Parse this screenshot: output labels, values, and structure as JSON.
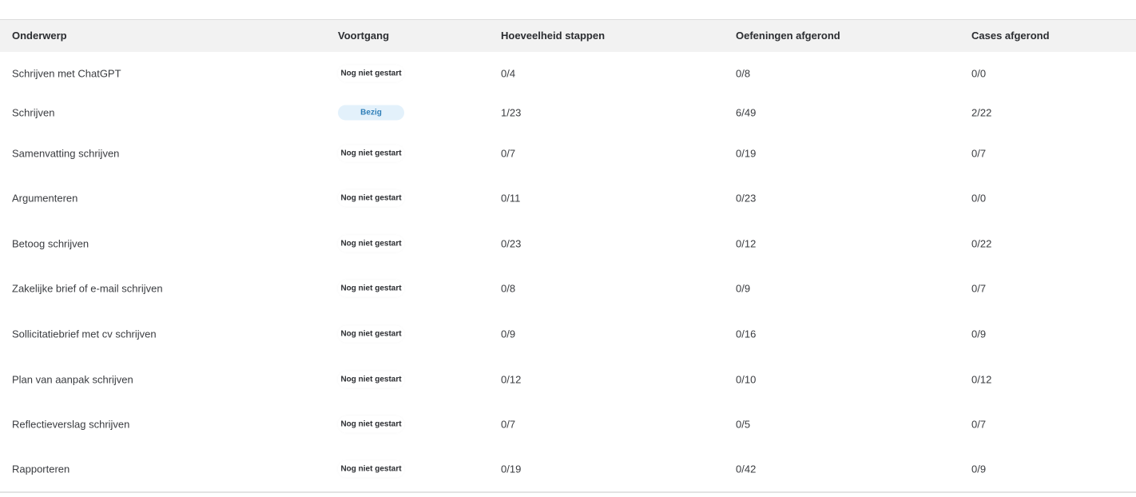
{
  "table": {
    "headers": {
      "topic": "Onderwerp",
      "progress": "Voortgang",
      "steps": "Hoeveelheid stappen",
      "exercises": "Oefeningen afgerond",
      "cases": "Cases afgerond"
    },
    "rows": [
      {
        "topic": "Schrijven met ChatGPT",
        "status": "Nog niet gestart",
        "status_key": "not-started",
        "steps": "0/4",
        "exercises": "0/8",
        "cases": "0/0"
      },
      {
        "topic": "Schrijven",
        "status": "Bezig",
        "status_key": "busy",
        "steps": "1/23",
        "exercises": "6/49",
        "cases": "2/22"
      },
      {
        "topic": "Samenvatting schrijven",
        "status": "Nog niet gestart",
        "status_key": "not-started",
        "steps": "0/7",
        "exercises": "0/19",
        "cases": "0/7"
      },
      {
        "topic": "Argumenteren",
        "status": "Nog niet gestart",
        "status_key": "not-started",
        "steps": "0/11",
        "exercises": "0/23",
        "cases": "0/0"
      },
      {
        "topic": "Betoog schrijven",
        "status": "Nog niet gestart",
        "status_key": "not-started",
        "steps": "0/23",
        "exercises": "0/12",
        "cases": "0/22"
      },
      {
        "topic": "Zakelijke brief of e-mail schrijven",
        "status": "Nog niet gestart",
        "status_key": "not-started",
        "steps": "0/8",
        "exercises": "0/9",
        "cases": "0/7"
      },
      {
        "topic": "Sollicitatiebrief met cv schrijven",
        "status": "Nog niet gestart",
        "status_key": "not-started",
        "steps": "0/9",
        "exercises": "0/16",
        "cases": "0/9"
      },
      {
        "topic": "Plan van aanpak schrijven",
        "status": "Nog niet gestart",
        "status_key": "not-started",
        "steps": "0/12",
        "exercises": "0/10",
        "cases": "0/12"
      },
      {
        "topic": "Reflectieverslag schrijven",
        "status": "Nog niet gestart",
        "status_key": "not-started",
        "steps": "0/7",
        "exercises": "0/5",
        "cases": "0/7"
      },
      {
        "topic": "Rapporteren",
        "status": "Nog niet gestart",
        "status_key": "not-started",
        "steps": "0/19",
        "exercises": "0/42",
        "cases": "0/9"
      }
    ]
  },
  "colors": {
    "header_bg": "#f2f2f2",
    "busy_badge_bg": "#e3f1fb",
    "busy_badge_text": "#2f7fb8"
  }
}
